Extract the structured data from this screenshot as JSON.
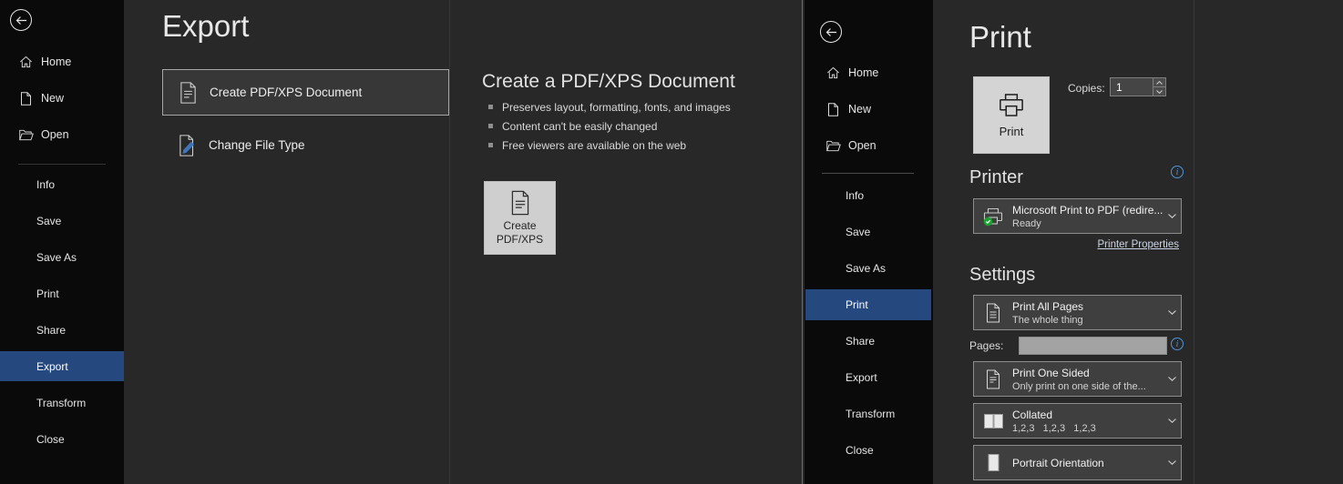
{
  "icons": {
    "info_glyph": "i",
    "back": "left-arrow-in-circle",
    "home": "house",
    "new": "blank-document",
    "open": "folder",
    "create_pdf_option": "document",
    "change_file_type": "document-with-blue-pencil",
    "create_pdf_button": "document-with-lines",
    "print_button": "printer",
    "printer_device": "printer-with-green-check",
    "print_all_pages": "document-with-lines",
    "print_one_sided": "document-with-lines",
    "collated": "side-by-side-pages",
    "portrait": "portrait-page",
    "chevron": "chevron-down",
    "spinner": "up-down-arrows"
  },
  "colors": {
    "accent_selected": "#25497e",
    "info_blue": "#4f96d8",
    "status_green": "#18a32c"
  },
  "export_view": {
    "title": "Export",
    "sidebar": {
      "top_items": [
        "Home",
        "New",
        "Open"
      ],
      "menu_items": [
        "Info",
        "Save",
        "Save As",
        "Print",
        "Share",
        "Export",
        "Transform",
        "Close"
      ],
      "selected_item": "Export"
    },
    "options": [
      {
        "label": "Create PDF/XPS Document"
      },
      {
        "label": "Change File Type"
      }
    ],
    "detail": {
      "heading": "Create a PDF/XPS Document",
      "bullets": [
        "Preserves layout, formatting, fonts, and images",
        "Content can't be easily changed",
        "Free viewers are available on the web"
      ],
      "button_line1": "Create",
      "button_line2": "PDF/XPS"
    }
  },
  "print_view": {
    "title": "Print",
    "sidebar": {
      "top_items": [
        "Home",
        "New",
        "Open"
      ],
      "menu_items": [
        "Info",
        "Save",
        "Save As",
        "Print",
        "Share",
        "Export",
        "Transform",
        "Close"
      ],
      "selected_item": "Print"
    },
    "print_button_label": "Print",
    "copies": {
      "label": "Copies:",
      "value": "1"
    },
    "printer": {
      "heading": "Printer",
      "name": "Microsoft Print to PDF (redire...",
      "status": "Ready",
      "properties_link": "Printer Properties"
    },
    "settings": {
      "heading": "Settings",
      "pages_label": "Pages:",
      "pages_value": "",
      "dropdowns": [
        {
          "line1": "Print All Pages",
          "line2": "The whole thing"
        },
        {
          "line1": "Print One Sided",
          "line2": "Only print on one side of the..."
        },
        {
          "line1": "Collated",
          "line2": "1,2,3   1,2,3   1,2,3"
        },
        {
          "line1": "Portrait Orientation",
          "line2": ""
        }
      ]
    }
  }
}
